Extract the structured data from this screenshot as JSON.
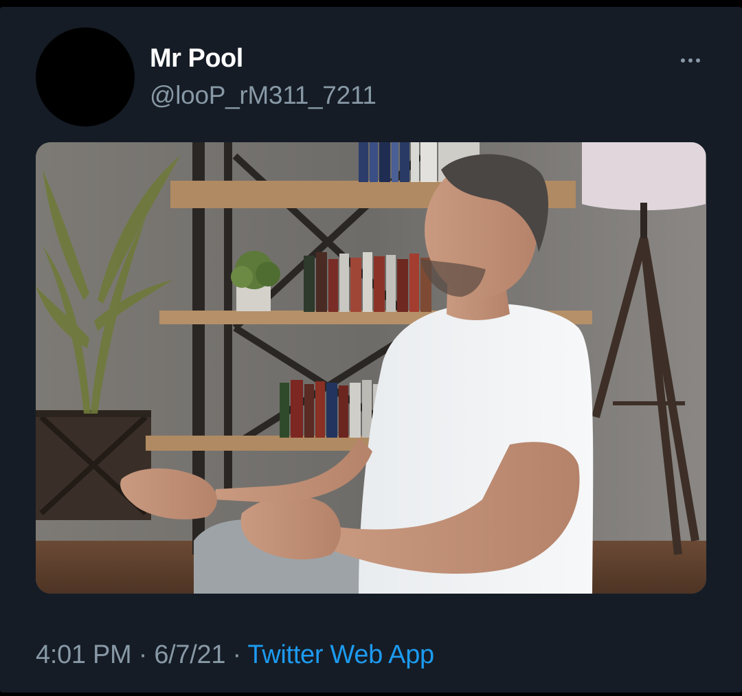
{
  "tweet": {
    "display_name": "Mr Pool",
    "handle": "@looP_rM311_7211",
    "more_icon": "more-horizontal-icon",
    "media": {
      "alt": "Man in white t-shirt meditating cross-legged in front of a bookshelf, plant and floor lamp"
    },
    "time": "4:01 PM",
    "separator": "·",
    "date": "6/7/21",
    "source": "Twitter Web App"
  },
  "colors": {
    "background": "#151c26",
    "text_primary": "#ffffff",
    "text_secondary": "#8899a6",
    "link": "#1d9bf0"
  }
}
